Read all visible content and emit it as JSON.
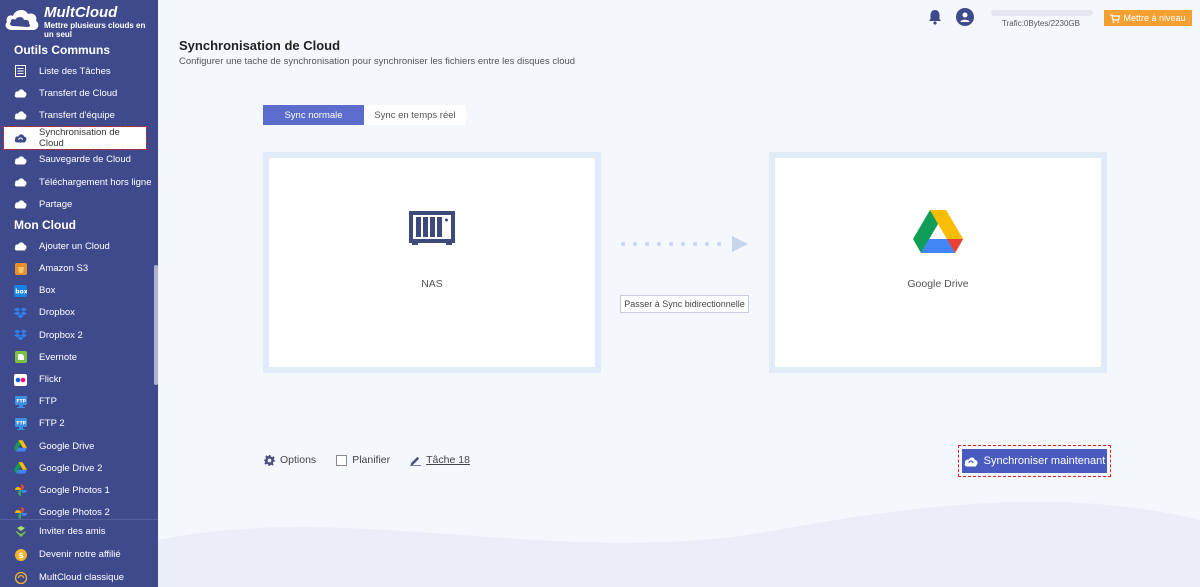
{
  "brand": {
    "name": "MultCloud",
    "slogan": "Mettre plusieurs clouds en un seul"
  },
  "sidebar": {
    "common_title": "Outils Communs",
    "common_items": [
      {
        "label": "Liste des Tâches",
        "icon": "task-list-icon"
      },
      {
        "label": "Transfert de Cloud",
        "icon": "cloud-transfer-icon"
      },
      {
        "label": "Transfert d'équipe",
        "icon": "team-transfer-icon"
      },
      {
        "label": "Synchronisation de Cloud",
        "icon": "cloud-sync-icon",
        "active": true
      },
      {
        "label": "Sauvegarde de Cloud",
        "icon": "cloud-backup-icon"
      },
      {
        "label": "Téléchargement hors ligne",
        "icon": "offline-download-icon"
      },
      {
        "label": "Partage",
        "icon": "share-icon"
      }
    ],
    "mycloud_title": "Mon Cloud",
    "mycloud_items": [
      {
        "label": "Ajouter un Cloud",
        "icon": "add-cloud-icon"
      },
      {
        "label": "Amazon S3",
        "icon": "amazon-s3-icon"
      },
      {
        "label": "Box",
        "icon": "box-icon"
      },
      {
        "label": "Dropbox",
        "icon": "dropbox-icon"
      },
      {
        "label": "Dropbox 2",
        "icon": "dropbox-icon"
      },
      {
        "label": "Evernote",
        "icon": "evernote-icon"
      },
      {
        "label": "Flickr",
        "icon": "flickr-icon"
      },
      {
        "label": "FTP",
        "icon": "ftp-icon"
      },
      {
        "label": "FTP 2",
        "icon": "ftp-icon"
      },
      {
        "label": "Google Drive",
        "icon": "google-drive-icon"
      },
      {
        "label": "Google Drive 2",
        "icon": "google-drive-icon"
      },
      {
        "label": "Google Photos 1",
        "icon": "google-photos-icon"
      },
      {
        "label": "Google Photos 2",
        "icon": "google-photos-icon"
      }
    ],
    "bottom_items": [
      {
        "label": "Inviter des amis",
        "icon": "gift-icon"
      },
      {
        "label": "Devenir notre affilié",
        "icon": "dollar-icon"
      },
      {
        "label": "MultCloud classique",
        "icon": "classic-icon"
      }
    ]
  },
  "topbar": {
    "traffic": "Trafic:0Bytes/2230GB",
    "traffic_used_fraction": 0,
    "upgrade_label": "Mettre à niveau"
  },
  "main": {
    "title": "Synchronisation de Cloud",
    "subtitle": "Configurer une tache de synchronisation pour synchroniser les fichiers entre les disques cloud",
    "tabs": {
      "normal": "Sync normale",
      "realtime": "Sync en temps réel"
    },
    "source_label": "NAS",
    "target_label": "Google Drive",
    "bidirectional_label": "Passer à Sync bidirectionnelle",
    "options_label": "Options",
    "schedule_label": "Planifier",
    "task_name": "Tâche 18",
    "sync_now_label": "Synchroniser maintenant"
  },
  "colors": {
    "sidebar": "#3f4a8c",
    "accent": "#4a5bc0",
    "upgrade": "#f5a032"
  }
}
